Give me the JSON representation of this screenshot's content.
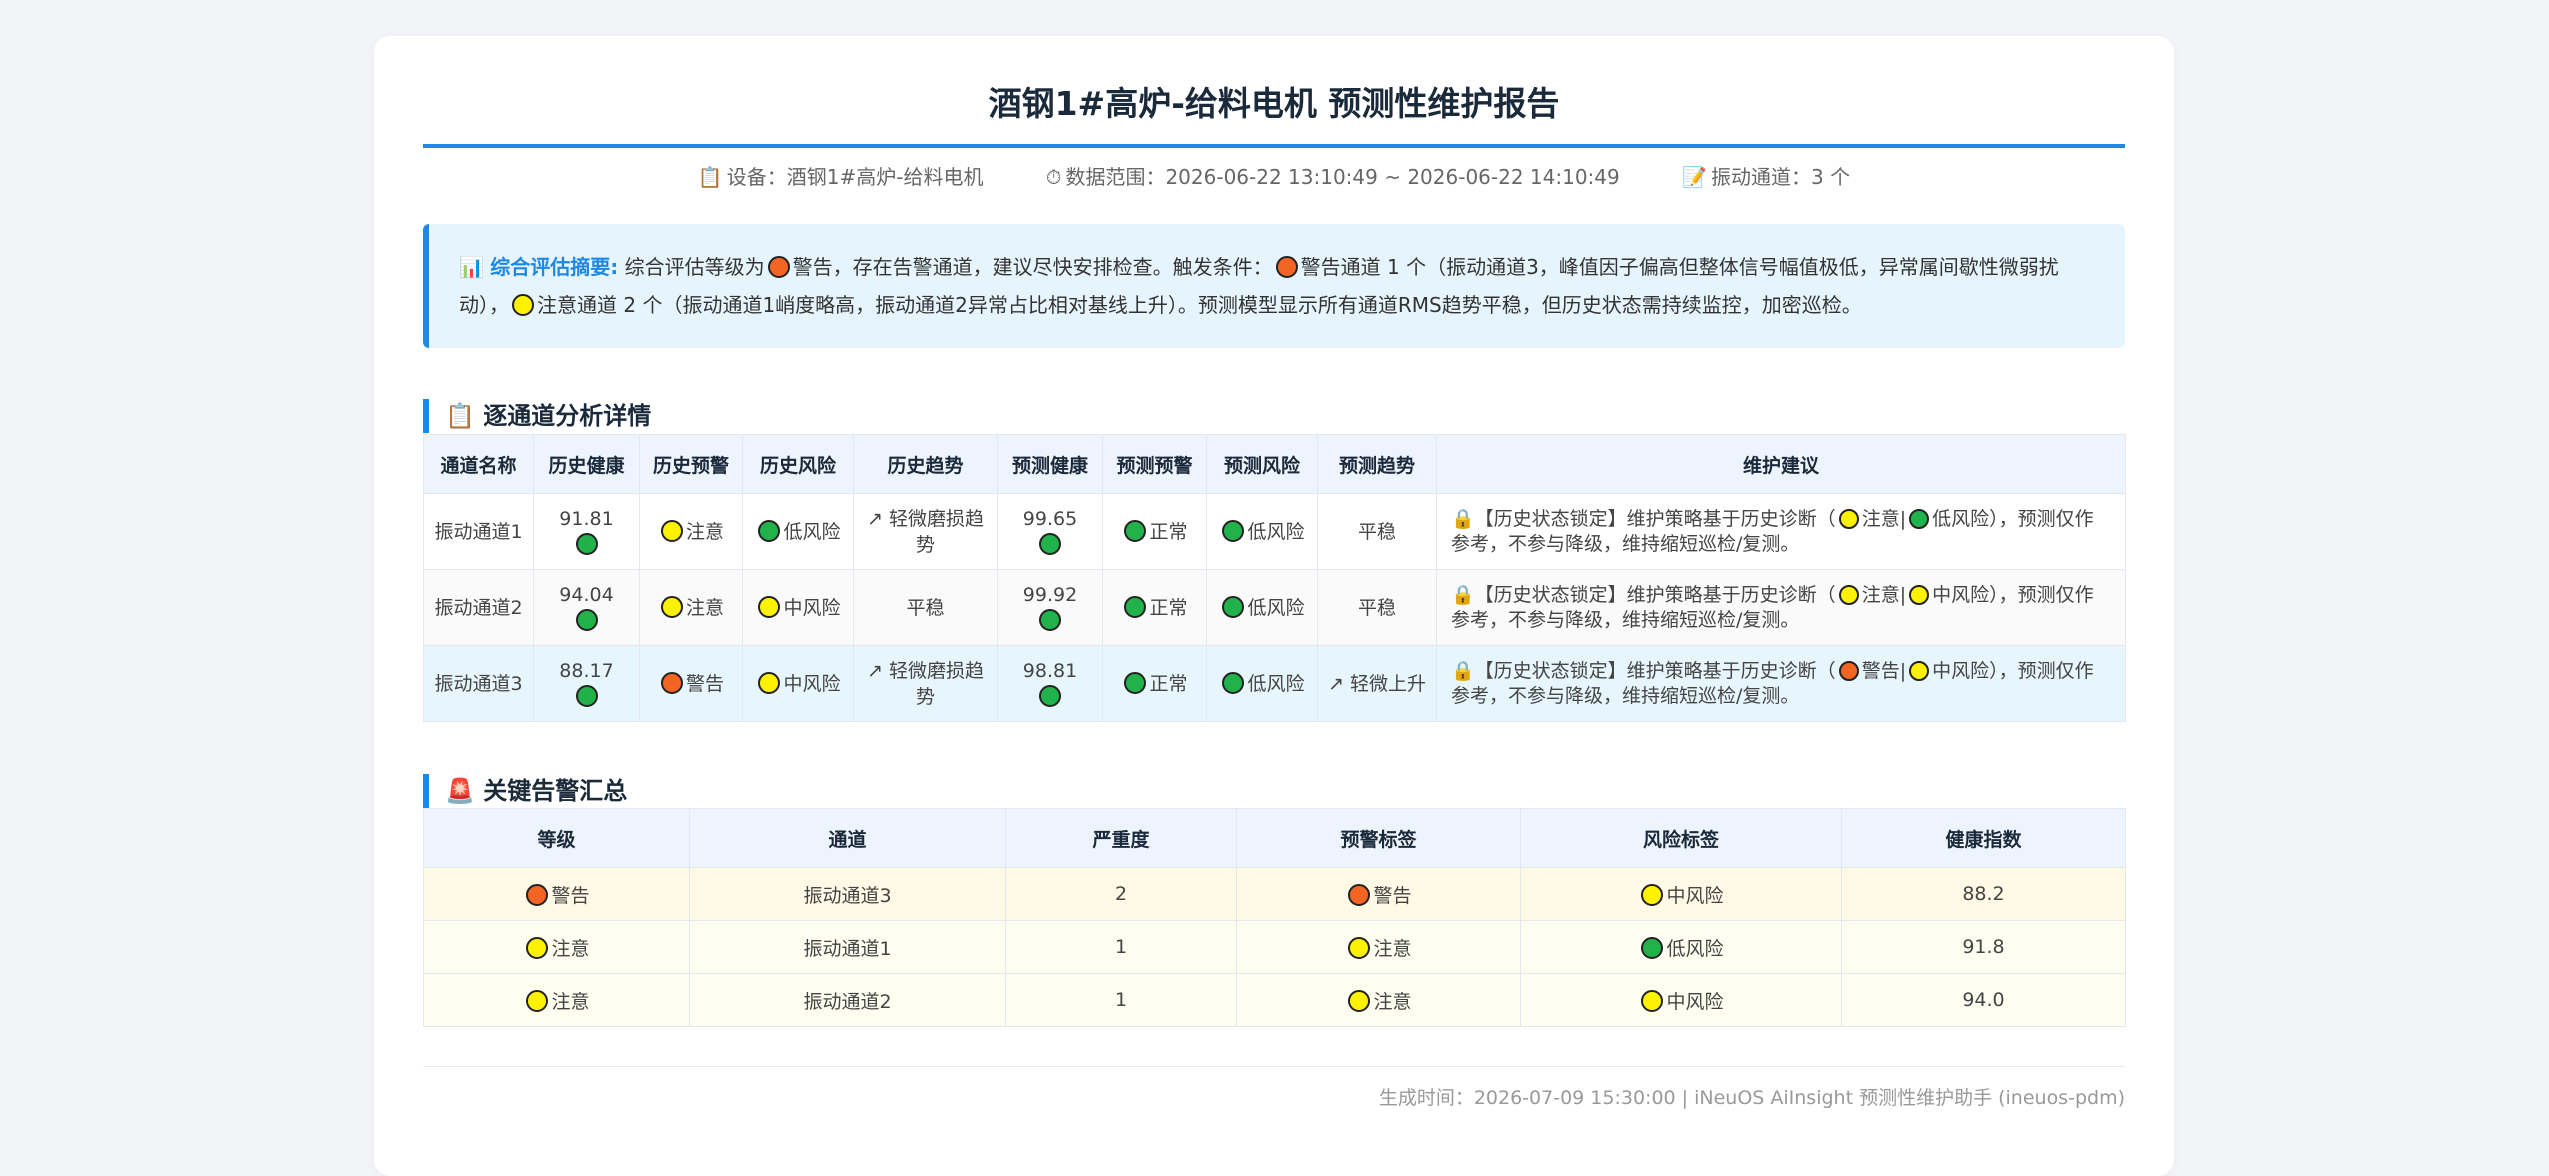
{
  "report": {
    "title": "酒钢1#高炉-给料电机 预测性维护报告",
    "meta": {
      "device_icon": "clipboard-icon",
      "device": "设备：酒钢1#高炉-给料电机",
      "range_icon": "stopwatch-icon",
      "range": "数据范围：2026-06-22 13:10:49 ~ 2026-06-22 14:10:49",
      "channels_icon": "pen-note-icon",
      "channels": "振动通道：3 个"
    },
    "summary": {
      "icon": "bar-chart-icon",
      "label": "综合评估摘要:",
      "t1": "综合评估等级为",
      "t2": "警告，存在告警通道，建议尽快安排检查。触发条件：",
      "t3": "警告通道 1 个（振动通道3，峰值因子偏高但整体信号幅值极低，异常属间歇性微弱扰动），",
      "t4": "注意通道 2 个（振动通道1峭度略高，振动通道2异常占比相对基线上升）。预测模型显示所有通道RMS趋势平稳，但历史状态需持续监控，加密巡检。"
    },
    "section1": {
      "icon": "clipboard-icon",
      "title": "逐通道分析详情"
    },
    "detail_table": {
      "headers": [
        "通道名称",
        "历史健康",
        "历史预警",
        "历史风险",
        "历史趋势",
        "预测健康",
        "预测预警",
        "预测风险",
        "预测趋势",
        "维护建议"
      ],
      "rows": [
        {
          "name": "振动通道1",
          "hist_health": "91.81",
          "hist_alert": "注意",
          "hist_risk": "低风险",
          "hist_trend": "↗ 轻微磨损趋势",
          "pred_health": "99.65",
          "pred_alert": "正常",
          "pred_risk": "低风险",
          "pred_trend": "平稳",
          "sugg_a": "【历史状态锁定】维护策略基于历史诊断（",
          "sugg_b": "注意|",
          "sugg_c": "低风险），预测仅作参考，不参与降级，维持缩短巡检/复测。"
        },
        {
          "name": "振动通道2",
          "hist_health": "94.04",
          "hist_alert": "注意",
          "hist_risk": "中风险",
          "hist_trend": "平稳",
          "pred_health": "99.92",
          "pred_alert": "正常",
          "pred_risk": "低风险",
          "pred_trend": "平稳",
          "sugg_a": "【历史状态锁定】维护策略基于历史诊断（",
          "sugg_b": "注意|",
          "sugg_c": "中风险），预测仅作参考，不参与降级，维持缩短巡检/复测。"
        },
        {
          "name": "振动通道3",
          "hist_health": "88.17",
          "hist_alert": "警告",
          "hist_risk": "中风险",
          "hist_trend": "↗ 轻微磨损趋势",
          "pred_health": "98.81",
          "pred_alert": "正常",
          "pred_risk": "低风险",
          "pred_trend": "↗ 轻微上升",
          "sugg_a": "【历史状态锁定】维护策略基于历史诊断（",
          "sugg_b": "警告|",
          "sugg_c": "中风险），预测仅作参考，不参与降级，维持缩短巡检/复测。"
        }
      ]
    },
    "section2": {
      "icon": "siren-icon",
      "title": "关键告警汇总"
    },
    "alert_table": {
      "headers": [
        "等级",
        "通道",
        "严重度",
        "预警标签",
        "风险标签",
        "健康指数"
      ],
      "rows": [
        {
          "level": "警告",
          "channel": "振动通道3",
          "severity": "2",
          "alert_tag": "警告",
          "risk_tag": "中风险",
          "health": "88.2"
        },
        {
          "level": "注意",
          "channel": "振动通道1",
          "severity": "1",
          "alert_tag": "注意",
          "risk_tag": "低风险",
          "health": "91.8"
        },
        {
          "level": "注意",
          "channel": "振动通道2",
          "severity": "1",
          "alert_tag": "注意",
          "risk_tag": "中风险",
          "health": "94.0"
        }
      ]
    },
    "footer": "生成时间：2026-07-09 15:30:00 | iNeuOS AiInsight 预测性维护助手 (ineuos-pdm)",
    "colors": {
      "accent": "#1e88e5",
      "warn": "#f26522",
      "note": "#fff200",
      "ok": "#22b24c"
    }
  }
}
